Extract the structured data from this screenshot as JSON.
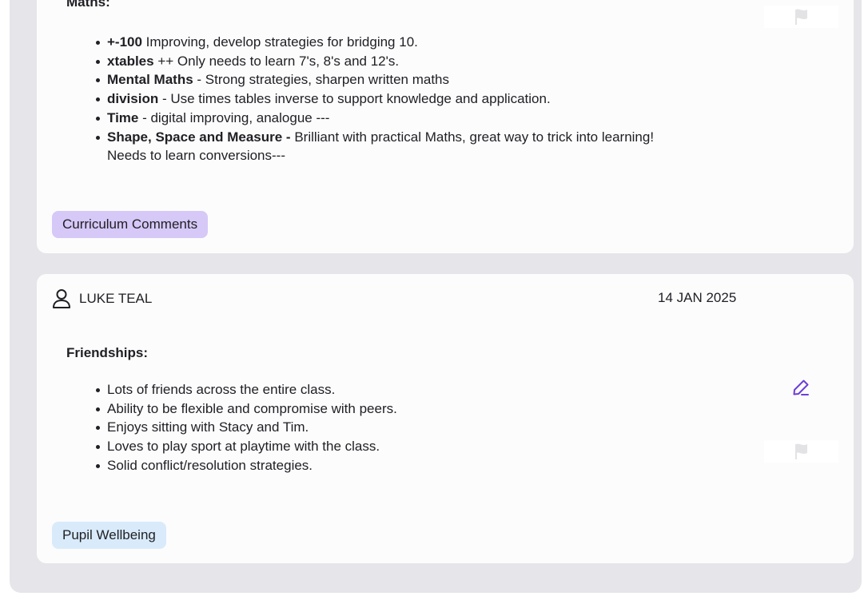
{
  "maths_card": {
    "section_title": "Maths:",
    "items": [
      {
        "bold": "+-100",
        "text": " Improving, develop strategies for bridging 10."
      },
      {
        "bold": "xtables",
        "text": " ++ Only needs to learn 7's, 8's and 12's."
      },
      {
        "bold": "Mental Maths",
        "text": " - Strong strategies, sharpen written maths"
      },
      {
        "bold": "division",
        "text": " - Use times tables inverse to support knowledge and application."
      },
      {
        "bold": "Time",
        "text": " - digital improving, analogue ---"
      },
      {
        "bold": "Shape, Space and Measure -",
        "text": " Brilliant with practical Maths, great way to trick into learning!",
        "continuation": "Needs to learn conversions---"
      }
    ],
    "tag": "Curriculum Comments",
    "tag_color": "#d6c8f7",
    "flag_icon": "flag-icon"
  },
  "wellbeing_card": {
    "author": "LUKE TEAL",
    "author_icon": "user-icon",
    "date": "14 JAN 2025",
    "section_title": "Friendships:",
    "items": [
      "Lots of friends across the entire class.",
      "Ability to be flexible and compromise with peers.",
      "Enjoys sitting with Stacy and Tim.",
      "Loves to play sport at playtime with the class.",
      "Solid conflict/resolution strategies."
    ],
    "tag": "Pupil Wellbeing",
    "tag_color": "#d9ebfa",
    "edit_icon": "pencil-icon",
    "edit_icon_color": "#6d3fd6",
    "flag_icon": "flag-icon"
  }
}
